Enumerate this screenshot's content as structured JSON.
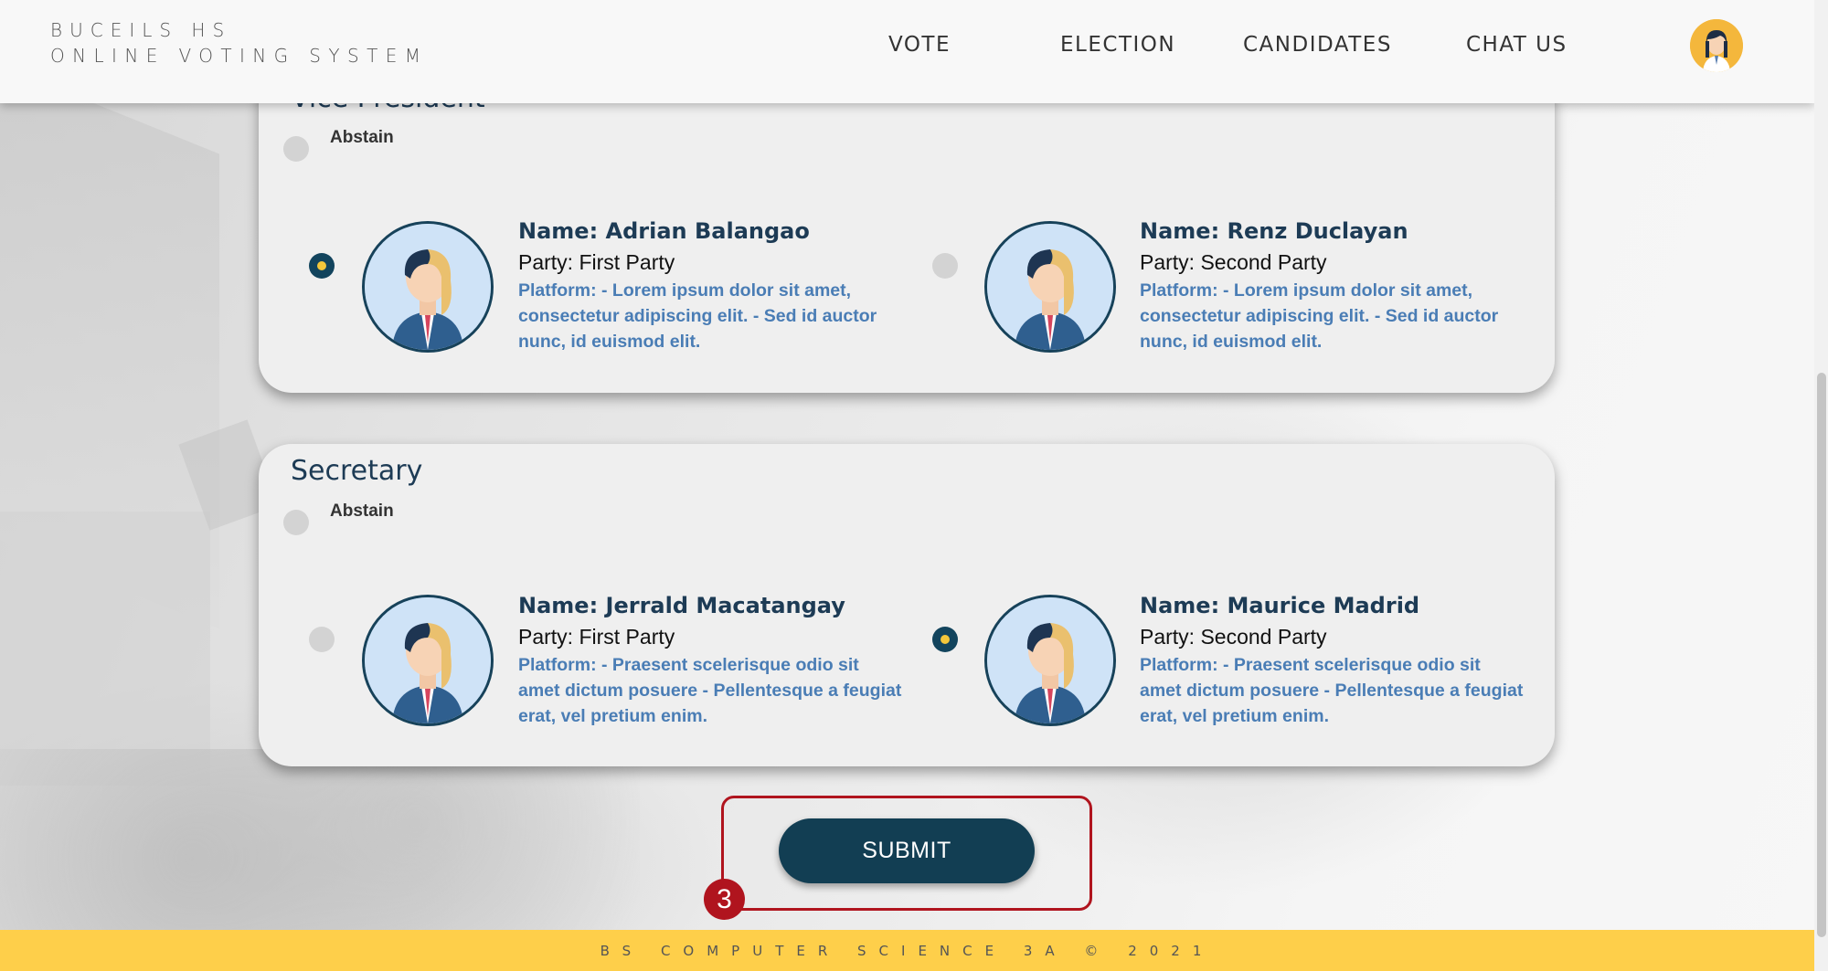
{
  "header": {
    "brand_line1": "BUCEILS HS",
    "brand_line2": "ONLINE VOTING SYSTEM",
    "nav": [
      "VOTE",
      "ELECTION",
      "CANDIDATES",
      "CHAT US"
    ]
  },
  "vice_president": {
    "title": "Vice President",
    "abstain_label": "Abstain",
    "candidates": [
      {
        "name": "Name: Adrian Balangao",
        "party": "Party: First Party",
        "platform": "Platform: - Lorem ipsum dolor sit amet, consectetur adipiscing elit. - Sed id auctor nunc, id euismod elit.",
        "selected": true
      },
      {
        "name": "Name: Renz Duclayan",
        "party": "Party: Second Party",
        "platform": "Platform: - Lorem ipsum dolor sit amet, consectetur adipiscing elit. - Sed id auctor nunc, id euismod elit.",
        "selected": false
      }
    ]
  },
  "secretary": {
    "title": "Secretary",
    "abstain_label": "Abstain",
    "candidates": [
      {
        "name": "Name: Jerrald Macatangay",
        "party": "Party: First Party",
        "platform": "Platform: - Praesent scelerisque odio sit amet dictum posuere - Pellentesque a feugiat erat, vel pretium enim.",
        "selected": false
      },
      {
        "name": "Name: Maurice Madrid",
        "party": "Party: Second Party",
        "platform": "Platform: - Praesent scelerisque odio sit amet dictum posuere - Pellentesque a feugiat erat, vel pretium enim.",
        "selected": true
      }
    ]
  },
  "submit_label": "SUBMIT",
  "step_badge": "3",
  "footer_text": "BS COMPUTER SCIENCE 3A © 2021",
  "colors": {
    "accent": "#123e53",
    "footer": "#fecf4a",
    "highlight": "#b0141e",
    "platform_text": "#4a7db5"
  }
}
